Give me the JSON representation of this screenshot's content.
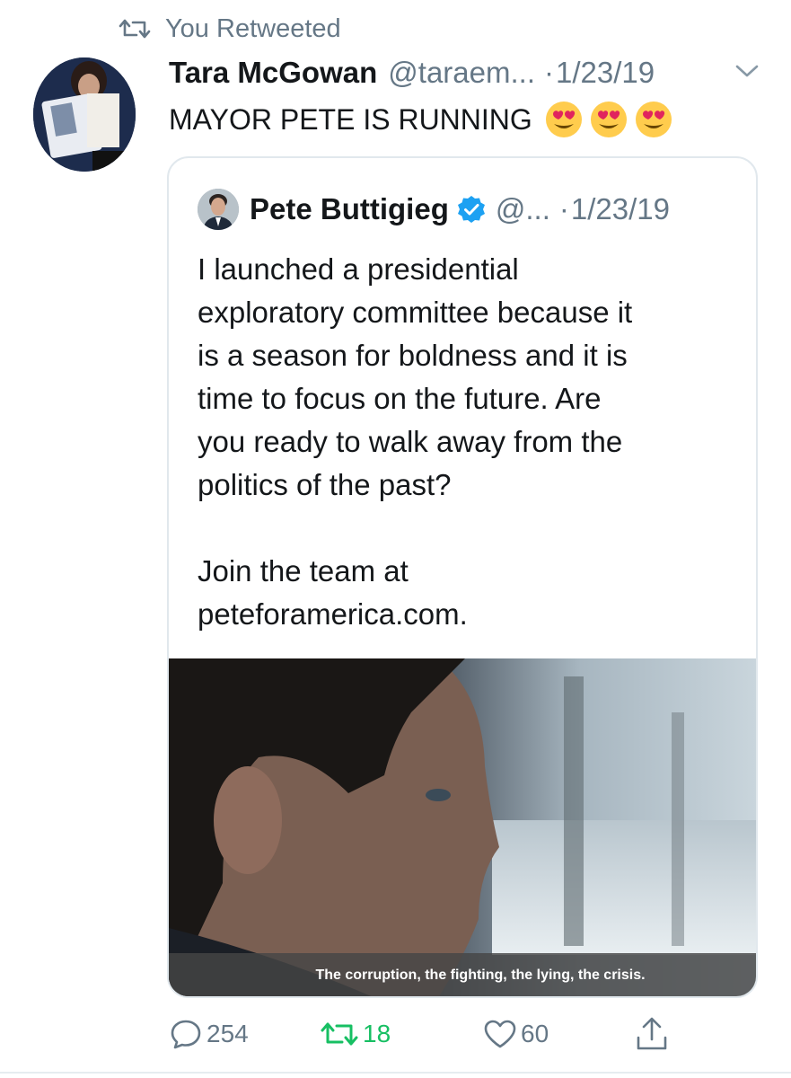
{
  "retweet_notice": "You Retweeted",
  "tweet": {
    "author_name": "Tara McGowan",
    "handle": "@taraem...",
    "separator": "·",
    "date": "1/23/19",
    "text": "MAYOR PETE IS RUNNING",
    "emojis": [
      "heart-eyes-emoji",
      "heart-eyes-emoji",
      "heart-eyes-emoji"
    ]
  },
  "quoted_tweet": {
    "author_name": "Pete Buttigieg",
    "handle": "@...",
    "separator": "·",
    "date": "1/23/19",
    "verified": true,
    "lines": [
      "I launched a presidential",
      "exploratory committee because it",
      "is a season for boldness and it is",
      "time to focus on the future. Are",
      "you ready to walk away from the",
      "politics of the past?",
      "",
      "Join the team at",
      "peteforamerica.com."
    ],
    "video_caption": "The corruption, the fighting, the lying, the crisis."
  },
  "actions": {
    "reply_count": "254",
    "retweet_count": "18",
    "like_count": "60"
  },
  "colors": {
    "secondary_text": "#657786",
    "retweet_active": "#17bf63",
    "verified_blue": "#1da1f2",
    "border": "#e1e8ed"
  }
}
